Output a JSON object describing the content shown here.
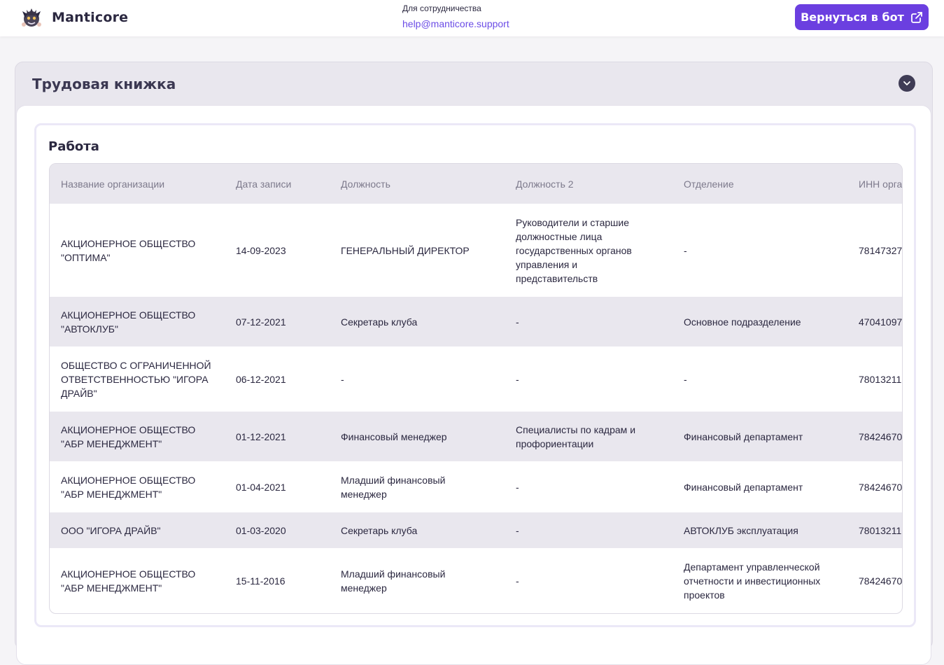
{
  "header": {
    "brand": "Manticore",
    "contact_label": "Для сотрудничества",
    "contact_email": "help@manticore.support",
    "back_button_label": "Вернуться в бот"
  },
  "panel": {
    "title": "Трудовая книжка"
  },
  "card": {
    "title": "Работа"
  },
  "table": {
    "columns": [
      "Название организации",
      "Дата записи",
      "Должность",
      "Должность 2",
      "Отделение",
      "ИНН организации"
    ],
    "rows": [
      [
        "АКЦИОНЕРНОЕ ОБЩЕСТВО \"ОПТИМА\"",
        "14-09-2023",
        "ГЕНЕРАЛЬНЫЙ ДИРЕКТОР",
        "Руководители и старшие должностные лица государственных органов управления и представительств",
        "-",
        "78147327"
      ],
      [
        "АКЦИОНЕРНОЕ ОБЩЕСТВО \"АВТОКЛУБ\"",
        "07-12-2021",
        "Секретарь клуба",
        "-",
        "Основное подразделение",
        "47041097"
      ],
      [
        "ОБЩЕСТВО С ОГРАНИЧЕННОЙ ОТВЕТСТВЕННОСТЬЮ \"ИГОРА ДРАЙВ\"",
        "06-12-2021",
        "-",
        "-",
        "-",
        "78013211"
      ],
      [
        "АКЦИОНЕРНОЕ ОБЩЕСТВО \"АБР МЕНЕДЖМЕНТ\"",
        "01-12-2021",
        "Финансовый менеджер",
        "Специалисты по кадрам и профориентации",
        "Финансовый департамент",
        "78424670"
      ],
      [
        "АКЦИОНЕРНОЕ ОБЩЕСТВО \"АБР МЕНЕДЖМЕНТ\"",
        "01-04-2021",
        "Младший финансовый менеджер",
        "-",
        "Финансовый департамент",
        "78424670"
      ],
      [
        "ООО \"ИГОРА ДРАЙВ\"",
        "01-03-2020",
        "Секретарь клуба",
        "-",
        "АВТОКЛУБ эксплуатация",
        "78013211"
      ],
      [
        "АКЦИОНЕРНОЕ ОБЩЕСТВО \"АБР МЕНЕДЖМЕНТ\"",
        "15-11-2016",
        "Младший финансовый менеджер",
        "-",
        "Департамент управленческой отчетности и инвестиционных проектов",
        "78424670"
      ]
    ]
  },
  "colors": {
    "accent": "#6b3fe0",
    "link": "#6b4ce6",
    "row_alt": "#e9e7ee"
  },
  "icons": {
    "logo": "manticore-mascot-icon",
    "external": "external-link-icon",
    "collapse": "chevron-down-icon"
  }
}
